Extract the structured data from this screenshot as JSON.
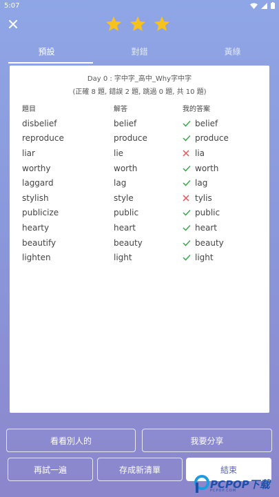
{
  "status": {
    "time": "5:07"
  },
  "tabs": [
    {
      "label": "預設",
      "active": true
    },
    {
      "label": "對錯",
      "active": false
    },
    {
      "label": "黃綠",
      "active": false
    }
  ],
  "stars": {
    "count": 3,
    "filled": 3,
    "color": "#f7c21c"
  },
  "result": {
    "title": "Day 0 : 字中字_高中_Why字中字",
    "summary": "(正確 8 題, 錯誤 2 題, 跳過 0 題, 共 10 題)",
    "headers": {
      "question": "題目",
      "answer": "解答",
      "mine": "我的答案"
    },
    "rows": [
      {
        "question": "disbelief",
        "answer": "belief",
        "mine": "belief",
        "correct": true
      },
      {
        "question": "reproduce",
        "answer": "produce",
        "mine": "produce",
        "correct": true
      },
      {
        "question": "liar",
        "answer": "lie",
        "mine": "lia",
        "correct": false
      },
      {
        "question": "worthy",
        "answer": "worth",
        "mine": "worth",
        "correct": true
      },
      {
        "question": "laggard",
        "answer": "lag",
        "mine": "lag",
        "correct": true
      },
      {
        "question": "stylish",
        "answer": "style",
        "mine": "tylis",
        "correct": false
      },
      {
        "question": "publicize",
        "answer": "public",
        "mine": "public",
        "correct": true
      },
      {
        "question": "hearty",
        "answer": "heart",
        "mine": "heart",
        "correct": true
      },
      {
        "question": "beautify",
        "answer": "beauty",
        "mine": "beauty",
        "correct": true
      },
      {
        "question": "lighten",
        "answer": "light",
        "mine": "light",
        "correct": true
      }
    ]
  },
  "buttons": {
    "see_others": "看看別人的",
    "share": "我要分享",
    "retry": "再試一遍",
    "save_list": "存成新清單",
    "finish": "結束"
  },
  "watermark": {
    "text": "PCPOP下载",
    "sub": "PCPOP.COM"
  },
  "colors": {
    "correct": "#3aa84a",
    "wrong": "#e05555",
    "accent": "#5a62b8"
  }
}
